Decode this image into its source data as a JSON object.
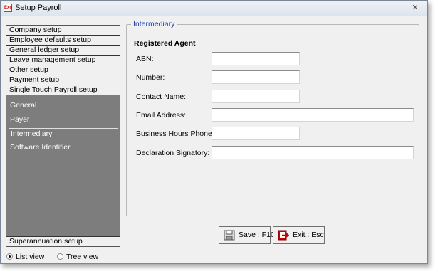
{
  "window": {
    "title": "Setup Payroll",
    "app_icon_text": "Exo"
  },
  "nav": {
    "items": [
      "Company setup",
      "Employee defaults setup",
      "General ledger setup",
      "Leave management setup",
      "Other setup",
      "Payment setup",
      "Single Touch Payroll setup"
    ],
    "sub_items": [
      "General",
      "Payer",
      "Intermediary",
      "Software Identifier"
    ],
    "selected_sub_item": "Intermediary",
    "bottom_item": "Superannuation setup"
  },
  "view_options": {
    "list": "List view",
    "tree": "Tree view",
    "selected": "list"
  },
  "form": {
    "group_title": "Intermediary",
    "section_title": "Registered Agent",
    "fields": {
      "abn": {
        "label": "ABN:",
        "value": ""
      },
      "number": {
        "label": "Number:",
        "value": ""
      },
      "contact_name": {
        "label": "Contact Name:",
        "value": ""
      },
      "email": {
        "label": "Email Address:",
        "value": ""
      },
      "phone": {
        "label": "Business Hours Phone:",
        "value": ""
      },
      "signatory": {
        "label": "Declaration Signatory:",
        "value": ""
      }
    }
  },
  "buttons": {
    "save": "Save : F10",
    "exit": "Exit : Esc"
  },
  "colors": {
    "group_title": "#1c3fb5",
    "nav_background": "#7d7d7d",
    "exit_icon": "#cc0000"
  }
}
